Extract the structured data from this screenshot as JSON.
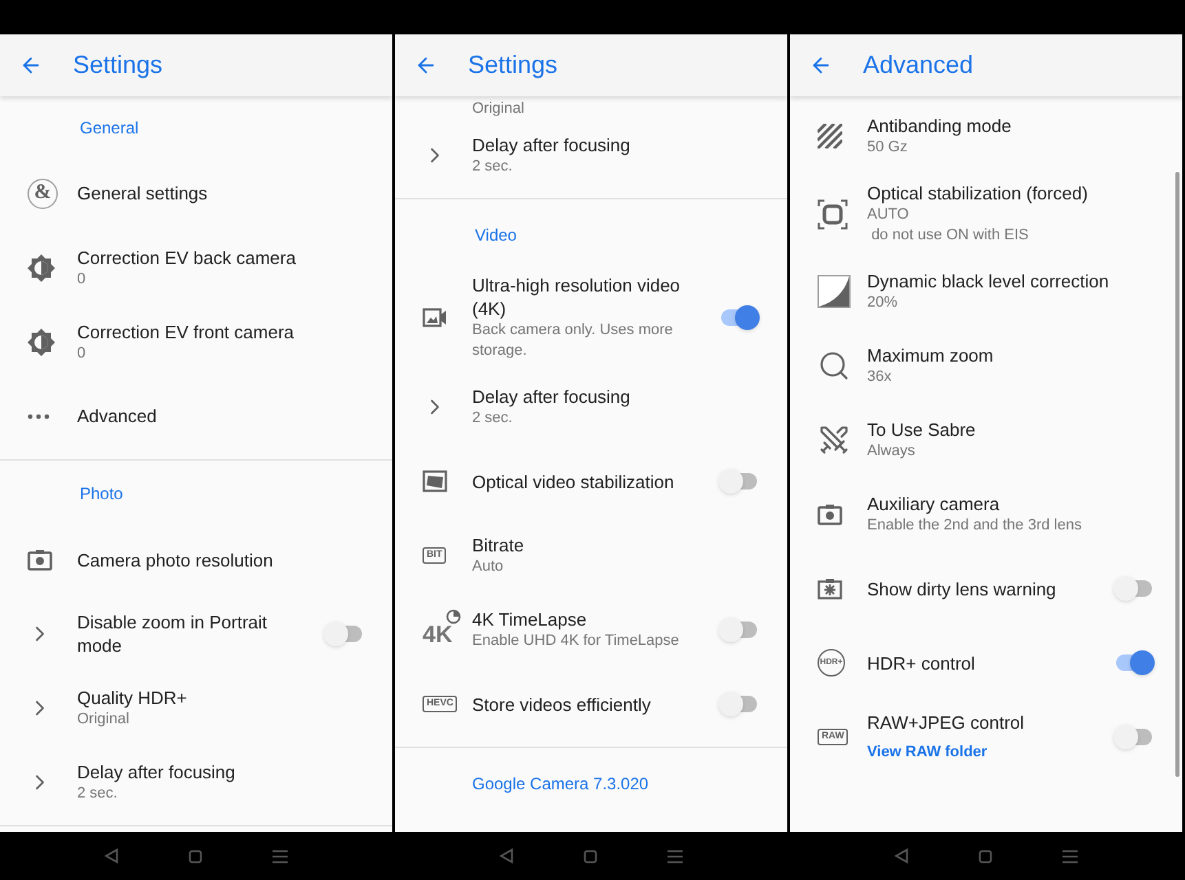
{
  "panels": [
    {
      "title": "Settings",
      "rows": [
        {
          "kind": "section",
          "text": "General"
        },
        {
          "kind": "item",
          "title": "General settings",
          "badge": "&"
        },
        {
          "kind": "item",
          "title": "Correction EV back camera",
          "lines": [
            "0"
          ]
        },
        {
          "kind": "item",
          "title": "Correction EV front camera",
          "lines": [
            "0"
          ]
        },
        {
          "kind": "item",
          "title": "Advanced"
        },
        {
          "kind": "divider"
        },
        {
          "kind": "section",
          "text": "Photo"
        },
        {
          "kind": "item",
          "title": "Camera photo resolution"
        },
        {
          "kind": "item",
          "title": "Disable zoom in Portrait mode",
          "toggle": {
            "on": false
          }
        },
        {
          "kind": "item",
          "title": "Quality HDR+",
          "lines": [
            "Original"
          ]
        },
        {
          "kind": "item",
          "title": "Delay after focusing",
          "lines": [
            "2 sec."
          ]
        },
        {
          "kind": "divider"
        }
      ]
    },
    {
      "title": "Settings",
      "rows": [
        {
          "kind": "fragment",
          "text": "Original"
        },
        {
          "kind": "item",
          "title": "Delay after focusing",
          "lines": [
            "2 sec."
          ]
        },
        {
          "kind": "divider"
        },
        {
          "kind": "section",
          "text": "Video"
        },
        {
          "kind": "item",
          "title": "Ultra-high resolution video (4K)",
          "lines": [
            "Back camera only. Uses more storage."
          ],
          "toggle": {
            "on": true
          }
        },
        {
          "kind": "item",
          "title": "Delay after focusing",
          "lines": [
            "2 sec."
          ]
        },
        {
          "kind": "item",
          "title": "Optical video stabilization",
          "toggle": {
            "on": false
          }
        },
        {
          "kind": "item",
          "title": "Bitrate",
          "lines": [
            "Auto"
          ],
          "badge": "BIT"
        },
        {
          "kind": "item",
          "title": "4K TimeLapse",
          "lines": [
            "Enable UHD 4K for TimeLapse"
          ],
          "toggle": {
            "on": false
          },
          "badge": "4K"
        },
        {
          "kind": "item",
          "title": "Store videos efficiently",
          "toggle": {
            "on": false
          },
          "badge": "HEVC"
        },
        {
          "kind": "divider"
        },
        {
          "kind": "footer",
          "text": "Google Camera 7.3.020"
        }
      ]
    },
    {
      "title": "Advanced",
      "rows": [
        {
          "kind": "item",
          "title": "Antibanding mode",
          "lines": [
            "50 Gz"
          ]
        },
        {
          "kind": "item",
          "title": "Optical stabilization (forced)",
          "lines": [
            "AUTO",
            " do not use ON with EIS"
          ]
        },
        {
          "kind": "item",
          "title": "Dynamic black level correction",
          "lines": [
            "20%"
          ]
        },
        {
          "kind": "item",
          "title": "Maximum zoom",
          "lines": [
            "36x"
          ]
        },
        {
          "kind": "item",
          "title": "To Use Sabre",
          "lines": [
            "Always"
          ]
        },
        {
          "kind": "item",
          "title": "Auxiliary camera",
          "lines": [
            "Enable the 2nd and the 3rd lens"
          ]
        },
        {
          "kind": "item",
          "title": "Show dirty lens warning",
          "toggle": {
            "on": false
          }
        },
        {
          "kind": "item",
          "title": "HDR+ control",
          "toggle": {
            "on": true
          },
          "badge": "HDR+"
        },
        {
          "kind": "item",
          "title": "RAW+JPEG control",
          "link": "View RAW folder",
          "toggle": {
            "on": false
          },
          "badge": "RAW"
        }
      ]
    }
  ]
}
